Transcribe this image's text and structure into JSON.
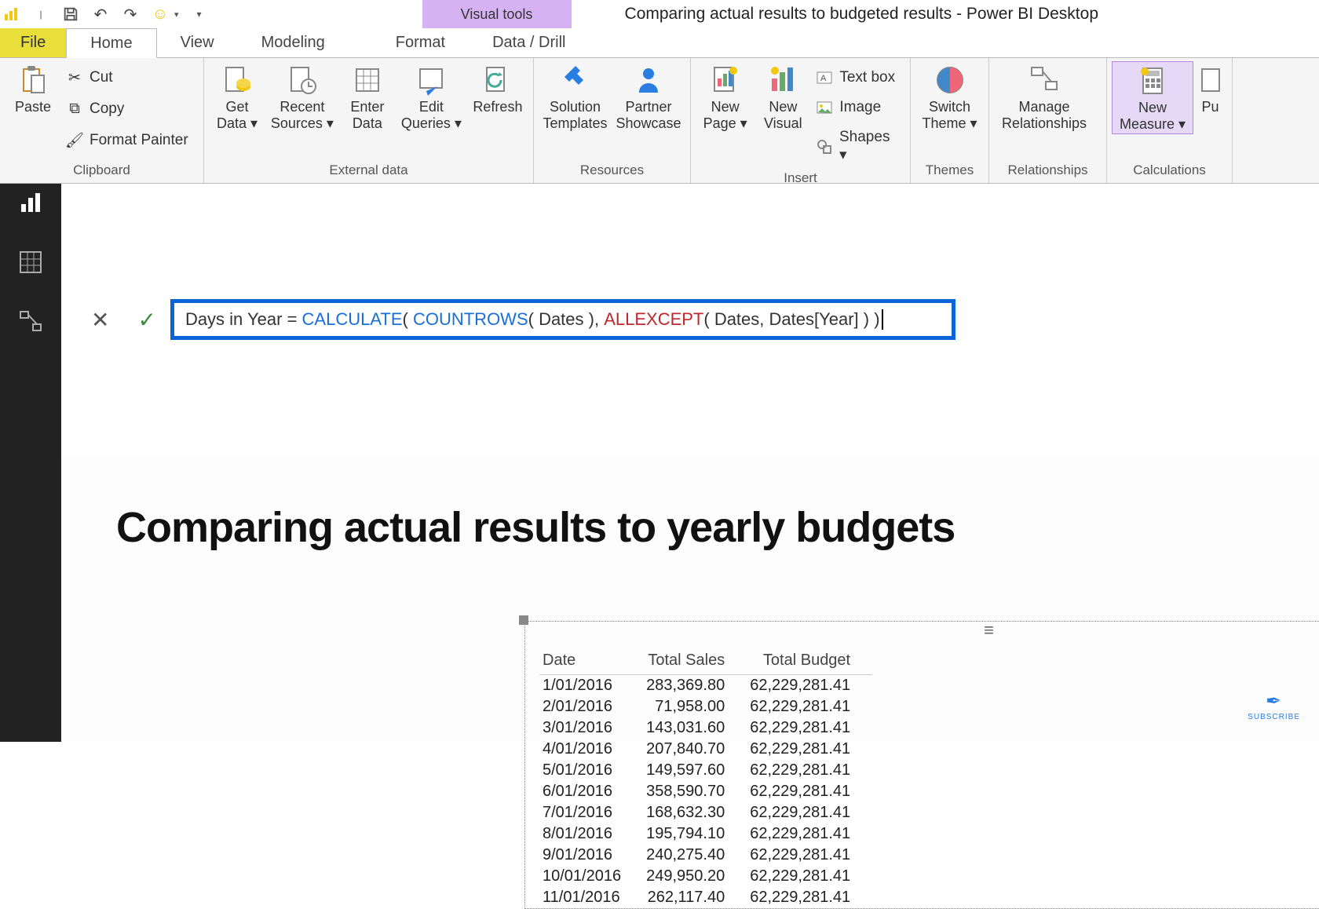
{
  "app": {
    "contextual_tab": "Visual tools",
    "title": "Comparing actual results to budgeted results - Power BI Desktop"
  },
  "tabs": {
    "file": "File",
    "home": "Home",
    "view": "View",
    "modeling": "Modeling",
    "format": "Format",
    "datadrill": "Data / Drill"
  },
  "ribbon": {
    "clipboard": {
      "label": "Clipboard",
      "paste": "Paste",
      "cut": "Cut",
      "copy": "Copy",
      "formatpainter": "Format Painter"
    },
    "externaldata": {
      "label": "External data",
      "getdata": "Get\nData ▾",
      "recent": "Recent\nSources ▾",
      "enter": "Enter\nData",
      "edit": "Edit\nQueries ▾",
      "refresh": "Refresh"
    },
    "resources": {
      "label": "Resources",
      "solution": "Solution\nTemplates",
      "partner": "Partner\nShowcase"
    },
    "insert": {
      "label": "Insert",
      "newpage": "New\nPage ▾",
      "newvisual": "New\nVisual",
      "textbox": "Text box",
      "image": "Image",
      "shapes": "Shapes ▾"
    },
    "themes": {
      "label": "Themes",
      "switch": "Switch\nTheme ▾"
    },
    "relationships": {
      "label": "Relationships",
      "manage": "Manage\nRelationships"
    },
    "calculations": {
      "label": "Calculations",
      "measure": "New\nMeasure ▾",
      "pu": "Pu"
    }
  },
  "formula": {
    "prefix": "Days in Year = ",
    "fn1": "CALCULATE",
    "p1": "( ",
    "fn2": "COUNTROWS",
    "p2": "( Dates ), ",
    "fn3": "ALLEXCEPT",
    "p3": "( Dates, Dates[Year] ) )"
  },
  "page": {
    "title": "Comparing actual results to yearly budgets",
    "columns": [
      "Date",
      "Total Sales",
      "Total Budget"
    ],
    "rows": [
      [
        "1/01/2016",
        "283,369.80",
        "62,229,281.41"
      ],
      [
        "2/01/2016",
        "71,958.00",
        "62,229,281.41"
      ],
      [
        "3/01/2016",
        "143,031.60",
        "62,229,281.41"
      ],
      [
        "4/01/2016",
        "207,840.70",
        "62,229,281.41"
      ],
      [
        "5/01/2016",
        "149,597.60",
        "62,229,281.41"
      ],
      [
        "6/01/2016",
        "358,590.70",
        "62,229,281.41"
      ],
      [
        "7/01/2016",
        "168,632.30",
        "62,229,281.41"
      ],
      [
        "8/01/2016",
        "195,794.10",
        "62,229,281.41"
      ],
      [
        "9/01/2016",
        "240,275.40",
        "62,229,281.41"
      ],
      [
        "10/01/2016",
        "249,950.20",
        "62,229,281.41"
      ],
      [
        "11/01/2016",
        "262,117.40",
        "62,229,281.41"
      ]
    ]
  },
  "subscribe": "SUBSCRIBE"
}
